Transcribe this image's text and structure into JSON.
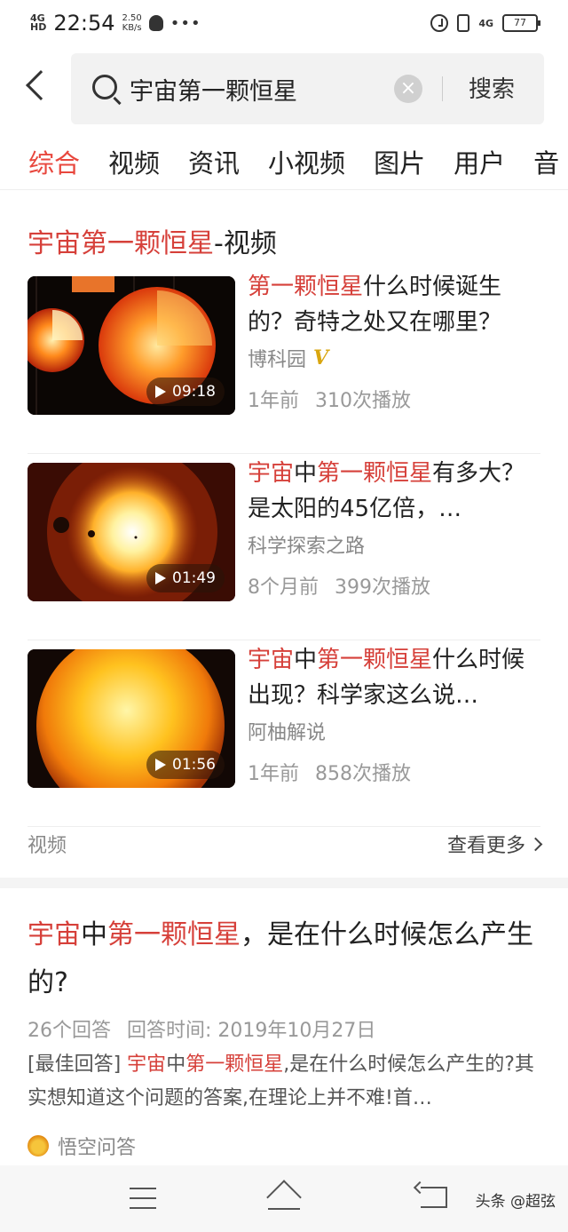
{
  "status_bar": {
    "network": "4G",
    "network_sub": "HD",
    "time": "22:54",
    "speed_value": "2.50",
    "speed_unit": "KB/s",
    "overflow": "•••",
    "network_right": "4G",
    "battery": "77",
    "icons": [
      "signal-icon",
      "qq-icon",
      "alarm-icon",
      "vibrate-icon",
      "battery-icon"
    ]
  },
  "search": {
    "query": "宇宙第一颗恒星",
    "button_label": "搜索",
    "clear_glyph": "×"
  },
  "tabs": [
    {
      "label": "综合",
      "active": true
    },
    {
      "label": "视频"
    },
    {
      "label": "资讯"
    },
    {
      "label": "小视频"
    },
    {
      "label": "图片"
    },
    {
      "label": "用户"
    },
    {
      "label": "音"
    }
  ],
  "video_section": {
    "title_highlight": "宇宙第一颗恒星",
    "title_suffix": "-视频",
    "items": [
      {
        "title_parts": [
          {
            "text": "第一颗恒星",
            "hl": true
          },
          {
            "text": "什么时候诞生的？奇特之处又在哪里？",
            "hl": false
          }
        ],
        "author": "博科园",
        "verified": "V",
        "age": "1年前",
        "plays": "310次播放",
        "duration": "09:18"
      },
      {
        "title_parts": [
          {
            "text": "宇宙",
            "hl": true
          },
          {
            "text": "中",
            "hl": false
          },
          {
            "text": "第一颗恒星",
            "hl": true
          },
          {
            "text": "有多大？是太阳的45亿倍，…",
            "hl": false
          }
        ],
        "author": "科学探索之路",
        "age": "8个月前",
        "plays": "399次播放",
        "duration": "01:49"
      },
      {
        "title_parts": [
          {
            "text": "宇宙",
            "hl": true
          },
          {
            "text": "中",
            "hl": false
          },
          {
            "text": "第一颗恒星",
            "hl": true
          },
          {
            "text": "什么时候出现？科学家这么说…",
            "hl": false
          }
        ],
        "author": "阿柚解说",
        "age": "1年前",
        "plays": "858次播放",
        "duration": "01:56"
      }
    ],
    "footer_label": "视频",
    "more_label": "查看更多"
  },
  "qa": {
    "title_parts": [
      {
        "text": "宇宙",
        "hl": true
      },
      {
        "text": "中",
        "hl": false
      },
      {
        "text": "第一颗恒星",
        "hl": true
      },
      {
        "text": "，是在什么时候怎么产生的?",
        "hl": false
      }
    ],
    "answers": "26个回答",
    "answer_time": "回答时间: 2019年10月27日",
    "snippet_parts": [
      {
        "text": "[最佳回答] ",
        "hl": false
      },
      {
        "text": "宇宙",
        "hl": true
      },
      {
        "text": "中",
        "hl": false
      },
      {
        "text": "第一颗恒星",
        "hl": true
      },
      {
        "text": ",是在什么时候怎么产生的?其实想知道这个问题的答案,在理论上并不难!首…",
        "hl": false
      }
    ],
    "source": "悟空问答"
  },
  "nav": {
    "watermark": "头条 @超弦"
  },
  "colors": {
    "highlight": "#d6403a",
    "active_tab": "#e8473d",
    "verified_badge": "#d9a60f"
  }
}
